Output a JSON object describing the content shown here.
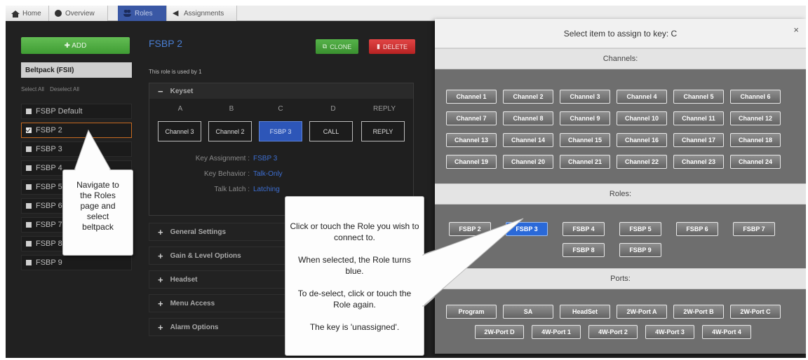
{
  "nav": {
    "tabs": [
      {
        "label": "Home",
        "icon": "home-icon"
      },
      {
        "label": "Overview",
        "icon": "globe-icon"
      },
      {
        "label": "Roles",
        "icon": "users-icon"
      },
      {
        "label": "Assignments",
        "icon": "assignments-icon"
      }
    ]
  },
  "sidebar": {
    "add_label": "✚ ADD",
    "header": "Beltpack (FSII)",
    "select_all": "Select All",
    "deselect_all": "Deselect All",
    "items": [
      "FSBP Default",
      "FSBP 2",
      "FSBP 3",
      "FSBP 4",
      "FSBP 5",
      "FSBP 6",
      "FSBP 7",
      "FSBP 8",
      "FSBP 9"
    ]
  },
  "role": {
    "title": "FSBP 2",
    "clone_label": "CLONE",
    "delete_label": "DELETE",
    "used_by": "This role is used by 1",
    "keyset_label": "Keyset",
    "key_columns": [
      "A",
      "B",
      "C",
      "D",
      "REPLY"
    ],
    "key_values": [
      "Channel 3",
      "Channel 2",
      "FSBP 3",
      "CALL",
      "REPLY"
    ],
    "key_assignment_label": "Key Assignment :",
    "key_assignment_value": "FSBP 3",
    "key_behavior_label": "Key Behavior :",
    "key_behavior_value": "Talk-Only",
    "talk_latch_label": "Talk Latch :",
    "talk_latch_value": "Latching",
    "sections": [
      "General Settings",
      "Gain & Level Options",
      "Headset",
      "Menu Access",
      "Alarm Options"
    ]
  },
  "callouts": {
    "left": [
      "Navigate to",
      "the Roles",
      "page and",
      "select",
      "beltpack"
    ],
    "right": [
      "Click or touch the Role you wish to connect to.",
      "When selected, the Role turns blue.",
      "To de-select, click or touch the Role again.",
      "The key is 'unassigned'."
    ]
  },
  "modal": {
    "title": "Select item to assign to key: C",
    "close": "×",
    "channels_label": "Channels:",
    "channels": [
      "Channel 1",
      "Channel 2",
      "Channel 3",
      "Channel 4",
      "Channel 5",
      "Channel 6",
      "Channel 7",
      "Channel 8",
      "Channel 9",
      "Channel 10",
      "Channel 11",
      "Channel 12",
      "Channel 13",
      "Channel 14",
      "Channel 15",
      "Channel 16",
      "Channel 17",
      "Channel 18",
      "Channel 19",
      "Channel 20",
      "Channel 21",
      "Channel 22",
      "Channel 23",
      "Channel 24"
    ],
    "roles_label": "Roles:",
    "roles": [
      "FSBP 2",
      "FSBP 3",
      "FSBP 4",
      "FSBP 5",
      "FSBP 6",
      "FSBP 7",
      "FSBP 8",
      "FSBP 9"
    ],
    "selected_role": "FSBP 3",
    "ports_label": "Ports:",
    "ports": [
      "Program",
      "SA",
      "HeadSet",
      "2W-Port A",
      "2W-Port B",
      "2W-Port C",
      "2W-Port D",
      "4W-Port 1",
      "4W-Port 2",
      "4W-Port 3",
      "4W-Port 4"
    ]
  },
  "colors": {
    "accent_blue": "#2a69d8",
    "add_green": "#4caf3f",
    "delete_red": "#d23030",
    "selected_outline": "#c76a20"
  }
}
